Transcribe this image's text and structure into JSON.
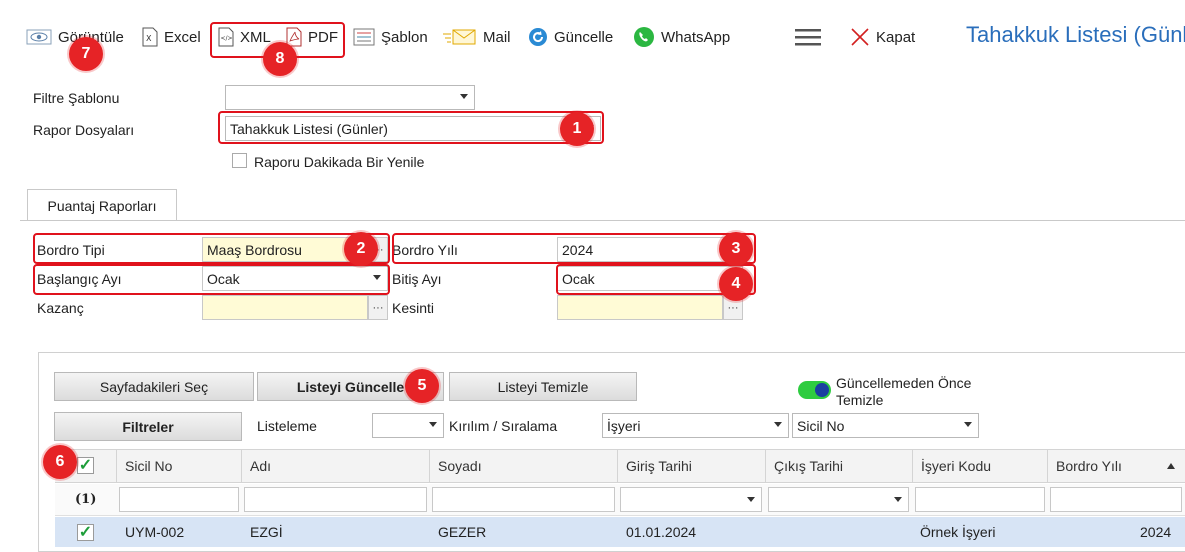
{
  "toolbar": {
    "view": "Görüntüle",
    "excel": "Excel",
    "xml": "XML",
    "pdf": "PDF",
    "template": "Şablon",
    "mail": "Mail",
    "refresh": "Güncelle",
    "whatsapp": "WhatsApp",
    "close": "Kapat",
    "title": "Tahakkuk Listesi (Günler)"
  },
  "filters": {
    "filter_template_label": "Filtre Şablonu",
    "filter_template_value": "",
    "report_files_label": "Rapor Dosyaları",
    "report_files_value": "Tahakkuk Listesi (Günler)",
    "auto_refresh_label": "Raporu Dakikada Bir Yenile"
  },
  "tab": {
    "label": "Puantaj Raporları"
  },
  "form": {
    "payroll_type_label": "Bordro Tipi",
    "payroll_type_value": "Maaş Bordrosu",
    "payroll_year_label": "Bordro Yılı",
    "payroll_year_value": "2024",
    "start_month_label": "Başlangıç Ayı",
    "start_month_value": "Ocak",
    "end_month_label": "Bitiş Ayı",
    "end_month_value": "Ocak",
    "earning_label": "Kazanç",
    "deduction_label": "Kesinti",
    "more": "···"
  },
  "actions": {
    "select_page": "Sayfadakileri Seç",
    "update_list": "Listeyi Güncelle",
    "clear_list": "Listeyi Temizle",
    "clear_before_update": "Güncellemeden Önce Temizle",
    "filters": "Filtreler",
    "listing_label": "Listeleme",
    "listing_value": "",
    "breakdown_label": "Kırılım / Sıralama",
    "breakdown_value1": "İşyeri",
    "breakdown_value2": "Sicil No"
  },
  "grid": {
    "columns": [
      "Sicil No",
      "Adı",
      "Soyadı",
      "Giriş Tarihi",
      "Çıkış Tarihi",
      "İşyeri Kodu",
      "Bordro Yılı"
    ],
    "count": "(1)",
    "rows": [
      {
        "sicil": "UYM-002",
        "ad": "EZGİ",
        "soyad": "GEZER",
        "giris": "01.01.2024",
        "cikis": "",
        "isyeri": "Örnek İşyeri",
        "yil": "2024"
      }
    ]
  },
  "badges": [
    "1",
    "2",
    "3",
    "4",
    "5",
    "6",
    "7",
    "8"
  ],
  "colors": {
    "highlight": "#e0121c",
    "badge": "#e62326",
    "title": "#2a6ebb",
    "row_selected": "#d7e4f5"
  }
}
